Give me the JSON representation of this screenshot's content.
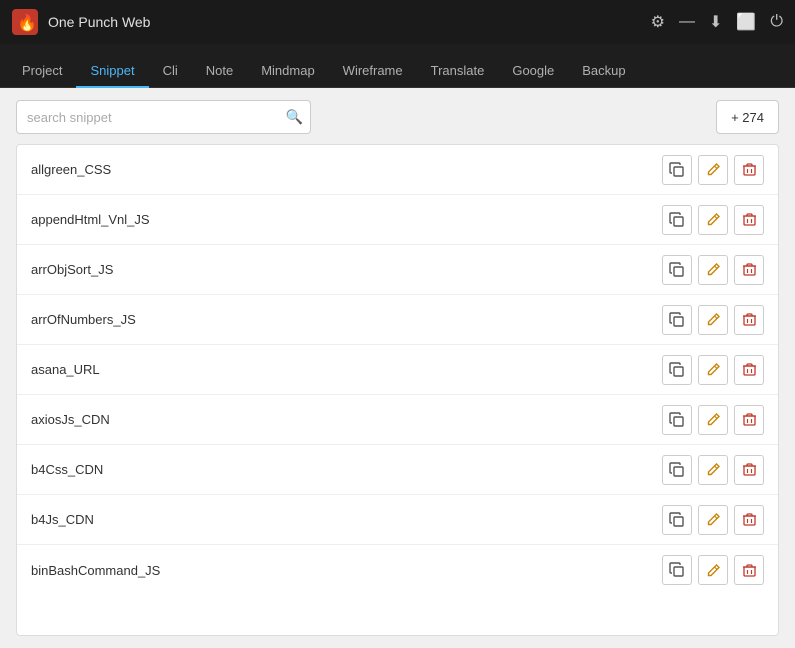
{
  "titleBar": {
    "title": "One Punch Web",
    "icons": [
      "gear",
      "minimize",
      "download",
      "maximize",
      "power"
    ]
  },
  "nav": {
    "tabs": [
      {
        "id": "project",
        "label": "Project",
        "active": false
      },
      {
        "id": "snippet",
        "label": "Snippet",
        "active": true
      },
      {
        "id": "cli",
        "label": "Cli",
        "active": false
      },
      {
        "id": "note",
        "label": "Note",
        "active": false
      },
      {
        "id": "mindmap",
        "label": "Mindmap",
        "active": false
      },
      {
        "id": "wireframe",
        "label": "Wireframe",
        "active": false
      },
      {
        "id": "translate",
        "label": "Translate",
        "active": false
      },
      {
        "id": "google",
        "label": "Google",
        "active": false
      },
      {
        "id": "backup",
        "label": "Backup",
        "active": false
      }
    ]
  },
  "search": {
    "placeholder": "search snippet"
  },
  "addButton": {
    "label": "+ 274"
  },
  "items": [
    {
      "name": "allgreen_CSS"
    },
    {
      "name": "appendHtml_Vnl_JS"
    },
    {
      "name": "arrObjSort_JS"
    },
    {
      "name": "arrOfNumbers_JS"
    },
    {
      "name": "asana_URL"
    },
    {
      "name": "axiosJs_CDN"
    },
    {
      "name": "b4Css_CDN"
    },
    {
      "name": "b4Js_CDN"
    },
    {
      "name": "binBashCommand_JS"
    }
  ],
  "actions": {
    "copy": "⧉",
    "edit": "✎",
    "delete": "🗑"
  }
}
